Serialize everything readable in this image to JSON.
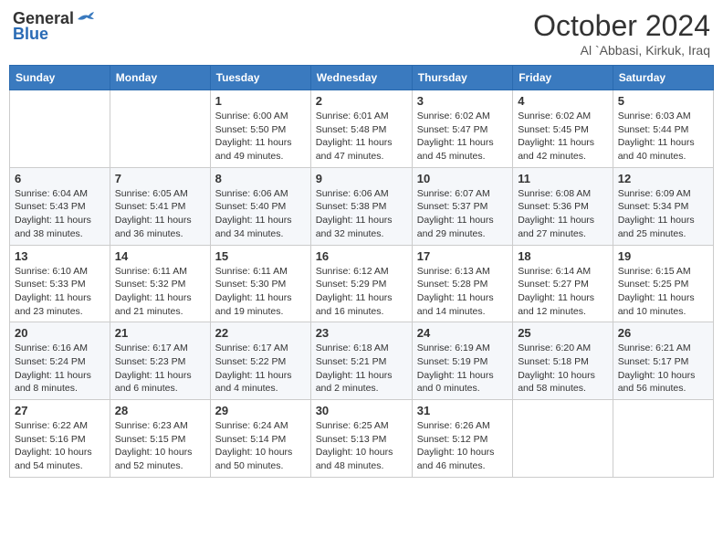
{
  "logo": {
    "general": "General",
    "blue": "Blue"
  },
  "title": "October 2024",
  "location": "Al `Abbasi, Kirkuk, Iraq",
  "days_of_week": [
    "Sunday",
    "Monday",
    "Tuesday",
    "Wednesday",
    "Thursday",
    "Friday",
    "Saturday"
  ],
  "weeks": [
    [
      {
        "day": "",
        "sunrise": "",
        "sunset": "",
        "daylight": ""
      },
      {
        "day": "",
        "sunrise": "",
        "sunset": "",
        "daylight": ""
      },
      {
        "day": "1",
        "sunrise": "Sunrise: 6:00 AM",
        "sunset": "Sunset: 5:50 PM",
        "daylight": "Daylight: 11 hours and 49 minutes."
      },
      {
        "day": "2",
        "sunrise": "Sunrise: 6:01 AM",
        "sunset": "Sunset: 5:48 PM",
        "daylight": "Daylight: 11 hours and 47 minutes."
      },
      {
        "day": "3",
        "sunrise": "Sunrise: 6:02 AM",
        "sunset": "Sunset: 5:47 PM",
        "daylight": "Daylight: 11 hours and 45 minutes."
      },
      {
        "day": "4",
        "sunrise": "Sunrise: 6:02 AM",
        "sunset": "Sunset: 5:45 PM",
        "daylight": "Daylight: 11 hours and 42 minutes."
      },
      {
        "day": "5",
        "sunrise": "Sunrise: 6:03 AM",
        "sunset": "Sunset: 5:44 PM",
        "daylight": "Daylight: 11 hours and 40 minutes."
      }
    ],
    [
      {
        "day": "6",
        "sunrise": "Sunrise: 6:04 AM",
        "sunset": "Sunset: 5:43 PM",
        "daylight": "Daylight: 11 hours and 38 minutes."
      },
      {
        "day": "7",
        "sunrise": "Sunrise: 6:05 AM",
        "sunset": "Sunset: 5:41 PM",
        "daylight": "Daylight: 11 hours and 36 minutes."
      },
      {
        "day": "8",
        "sunrise": "Sunrise: 6:06 AM",
        "sunset": "Sunset: 5:40 PM",
        "daylight": "Daylight: 11 hours and 34 minutes."
      },
      {
        "day": "9",
        "sunrise": "Sunrise: 6:06 AM",
        "sunset": "Sunset: 5:38 PM",
        "daylight": "Daylight: 11 hours and 32 minutes."
      },
      {
        "day": "10",
        "sunrise": "Sunrise: 6:07 AM",
        "sunset": "Sunset: 5:37 PM",
        "daylight": "Daylight: 11 hours and 29 minutes."
      },
      {
        "day": "11",
        "sunrise": "Sunrise: 6:08 AM",
        "sunset": "Sunset: 5:36 PM",
        "daylight": "Daylight: 11 hours and 27 minutes."
      },
      {
        "day": "12",
        "sunrise": "Sunrise: 6:09 AM",
        "sunset": "Sunset: 5:34 PM",
        "daylight": "Daylight: 11 hours and 25 minutes."
      }
    ],
    [
      {
        "day": "13",
        "sunrise": "Sunrise: 6:10 AM",
        "sunset": "Sunset: 5:33 PM",
        "daylight": "Daylight: 11 hours and 23 minutes."
      },
      {
        "day": "14",
        "sunrise": "Sunrise: 6:11 AM",
        "sunset": "Sunset: 5:32 PM",
        "daylight": "Daylight: 11 hours and 21 minutes."
      },
      {
        "day": "15",
        "sunrise": "Sunrise: 6:11 AM",
        "sunset": "Sunset: 5:30 PM",
        "daylight": "Daylight: 11 hours and 19 minutes."
      },
      {
        "day": "16",
        "sunrise": "Sunrise: 6:12 AM",
        "sunset": "Sunset: 5:29 PM",
        "daylight": "Daylight: 11 hours and 16 minutes."
      },
      {
        "day": "17",
        "sunrise": "Sunrise: 6:13 AM",
        "sunset": "Sunset: 5:28 PM",
        "daylight": "Daylight: 11 hours and 14 minutes."
      },
      {
        "day": "18",
        "sunrise": "Sunrise: 6:14 AM",
        "sunset": "Sunset: 5:27 PM",
        "daylight": "Daylight: 11 hours and 12 minutes."
      },
      {
        "day": "19",
        "sunrise": "Sunrise: 6:15 AM",
        "sunset": "Sunset: 5:25 PM",
        "daylight": "Daylight: 11 hours and 10 minutes."
      }
    ],
    [
      {
        "day": "20",
        "sunrise": "Sunrise: 6:16 AM",
        "sunset": "Sunset: 5:24 PM",
        "daylight": "Daylight: 11 hours and 8 minutes."
      },
      {
        "day": "21",
        "sunrise": "Sunrise: 6:17 AM",
        "sunset": "Sunset: 5:23 PM",
        "daylight": "Daylight: 11 hours and 6 minutes."
      },
      {
        "day": "22",
        "sunrise": "Sunrise: 6:17 AM",
        "sunset": "Sunset: 5:22 PM",
        "daylight": "Daylight: 11 hours and 4 minutes."
      },
      {
        "day": "23",
        "sunrise": "Sunrise: 6:18 AM",
        "sunset": "Sunset: 5:21 PM",
        "daylight": "Daylight: 11 hours and 2 minutes."
      },
      {
        "day": "24",
        "sunrise": "Sunrise: 6:19 AM",
        "sunset": "Sunset: 5:19 PM",
        "daylight": "Daylight: 11 hours and 0 minutes."
      },
      {
        "day": "25",
        "sunrise": "Sunrise: 6:20 AM",
        "sunset": "Sunset: 5:18 PM",
        "daylight": "Daylight: 10 hours and 58 minutes."
      },
      {
        "day": "26",
        "sunrise": "Sunrise: 6:21 AM",
        "sunset": "Sunset: 5:17 PM",
        "daylight": "Daylight: 10 hours and 56 minutes."
      }
    ],
    [
      {
        "day": "27",
        "sunrise": "Sunrise: 6:22 AM",
        "sunset": "Sunset: 5:16 PM",
        "daylight": "Daylight: 10 hours and 54 minutes."
      },
      {
        "day": "28",
        "sunrise": "Sunrise: 6:23 AM",
        "sunset": "Sunset: 5:15 PM",
        "daylight": "Daylight: 10 hours and 52 minutes."
      },
      {
        "day": "29",
        "sunrise": "Sunrise: 6:24 AM",
        "sunset": "Sunset: 5:14 PM",
        "daylight": "Daylight: 10 hours and 50 minutes."
      },
      {
        "day": "30",
        "sunrise": "Sunrise: 6:25 AM",
        "sunset": "Sunset: 5:13 PM",
        "daylight": "Daylight: 10 hours and 48 minutes."
      },
      {
        "day": "31",
        "sunrise": "Sunrise: 6:26 AM",
        "sunset": "Sunset: 5:12 PM",
        "daylight": "Daylight: 10 hours and 46 minutes."
      },
      {
        "day": "",
        "sunrise": "",
        "sunset": "",
        "daylight": ""
      },
      {
        "day": "",
        "sunrise": "",
        "sunset": "",
        "daylight": ""
      }
    ]
  ]
}
